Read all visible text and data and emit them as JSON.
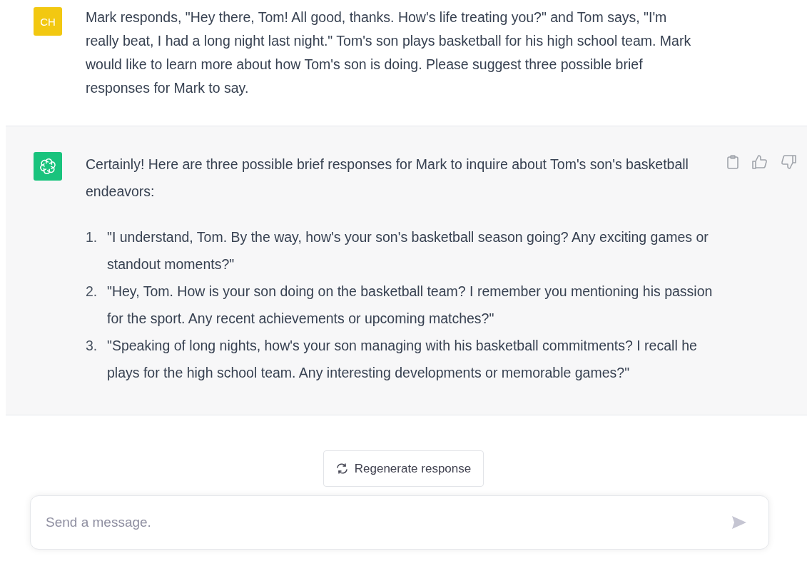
{
  "messages": [
    {
      "kind": "user",
      "avatar": "CH",
      "text": "Mark responds, \"Hey there, Tom! All good, thanks. How's life treating you?\" and Tom says, \"I'm really beat, I had a long night last night.\" Tom's son plays basketball for his high school team.  Mark would like to learn more about how Tom's son is doing. Please suggest three possible brief responses for Mark to say."
    },
    {
      "kind": "assistant",
      "text": "Certainly! Here are three possible brief responses for Mark to inquire about Tom's son's basketball endeavors:",
      "list": [
        {
          "number": "1.",
          "text": "\"I understand, Tom. By the way, how's your son's basketball season going? Any exciting games or standout moments?\""
        },
        {
          "number": "2.",
          "text": "\"Hey, Tom. How is your son doing on the basketball team? I remember you mentioning his passion for the sport. Any recent achievements or upcoming matches?\""
        },
        {
          "number": "3.",
          "text": "\"Speaking of long nights, how's your son managing with his basketball commitments? I recall he plays for the high school team. Any interesting developments or memorable games?\""
        }
      ]
    }
  ],
  "regenerate_button": "Regenerate response",
  "composer": {
    "placeholder": "Send a message."
  }
}
